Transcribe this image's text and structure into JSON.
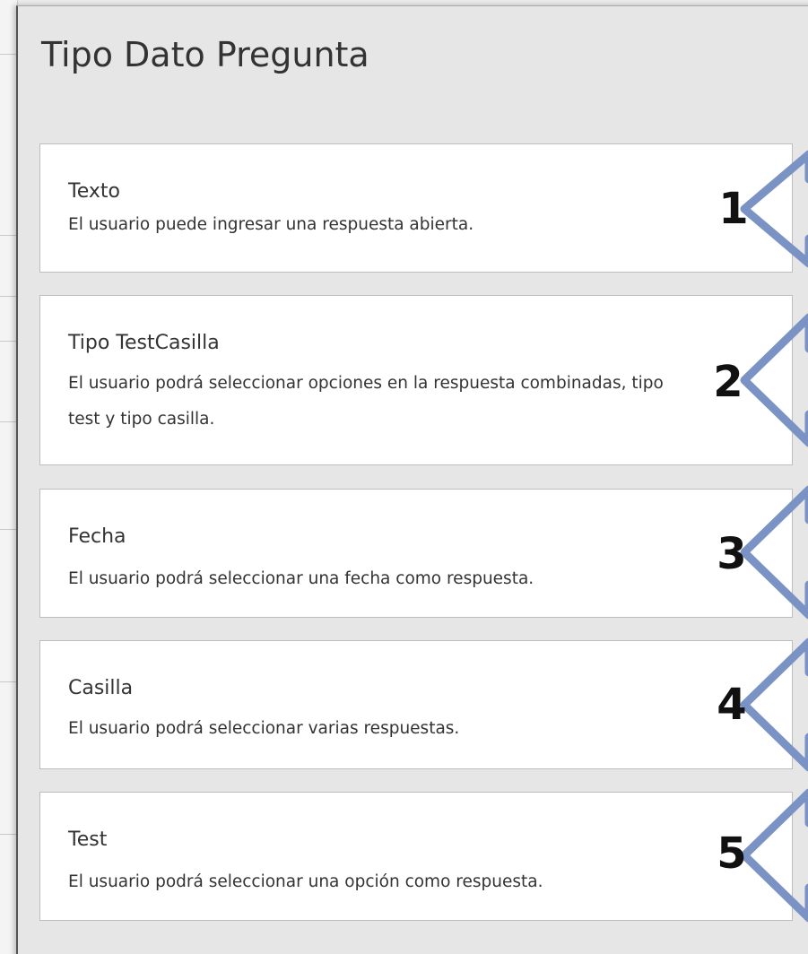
{
  "dialog": {
    "title": "Tipo Dato Pregunta"
  },
  "options": [
    {
      "title": "Texto",
      "description": "El usuario puede ingresar una respuesta abierta.",
      "marker": "1"
    },
    {
      "title": "Tipo TestCasilla",
      "description": "El usuario podrá seleccionar opciones en la respuesta combinadas, tipo test y tipo casilla.",
      "marker": "2"
    },
    {
      "title": "Fecha",
      "description": "El usuario podrá seleccionar una fecha como respuesta.",
      "marker": "3"
    },
    {
      "title": "Casilla",
      "description": "El usuario podrá seleccionar varias respuestas.",
      "marker": "4"
    },
    {
      "title": "Test",
      "description": "El usuario podrá seleccionar una opción como respuesta.",
      "marker": "5"
    }
  ],
  "annotation_arrow_color": "#7a93c4"
}
